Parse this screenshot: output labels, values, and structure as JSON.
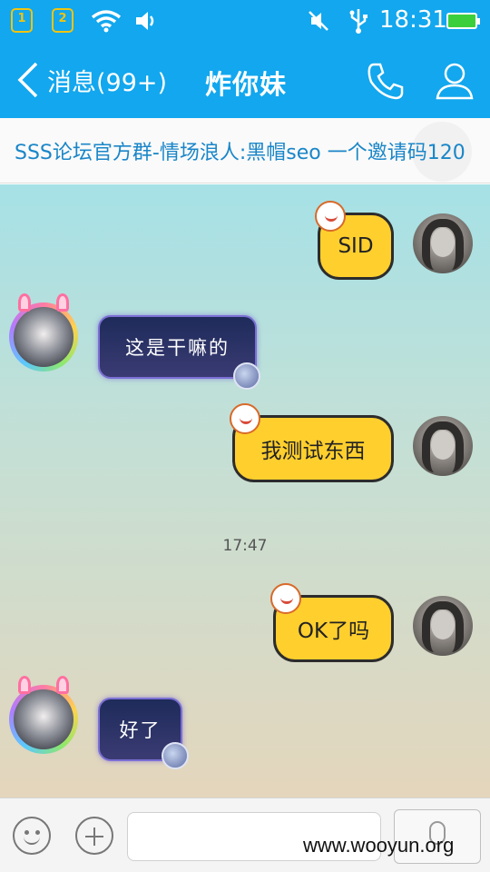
{
  "status_bar": {
    "sim1": "1",
    "sim2": "2",
    "time": "18:31"
  },
  "header": {
    "back_label": "消息(99+)",
    "title": "炸你妹",
    "icons": [
      "phone-icon",
      "profile-icon"
    ]
  },
  "notice": {
    "text": "SSS论坛官方群-情场浪人:黑帽seo 一个邀请码120"
  },
  "messages": [
    {
      "side": "me",
      "text": "SID"
    },
    {
      "side": "other",
      "text": "这是干嘛的"
    },
    {
      "side": "me",
      "text": "我测试东西"
    },
    {
      "side": "me",
      "text": "OK了吗"
    },
    {
      "side": "other",
      "text": "好了"
    }
  ],
  "timestamp": "17:47",
  "input_bar": {
    "placeholder": "",
    "icons": [
      "emoji-icon",
      "plus-icon",
      "microphone-icon"
    ]
  },
  "watermark": "www.wooyun.org",
  "colors": {
    "header_blue": "#12a7ee",
    "my_bubble": "#ffcf2e",
    "other_bubble": "#2a3366"
  }
}
